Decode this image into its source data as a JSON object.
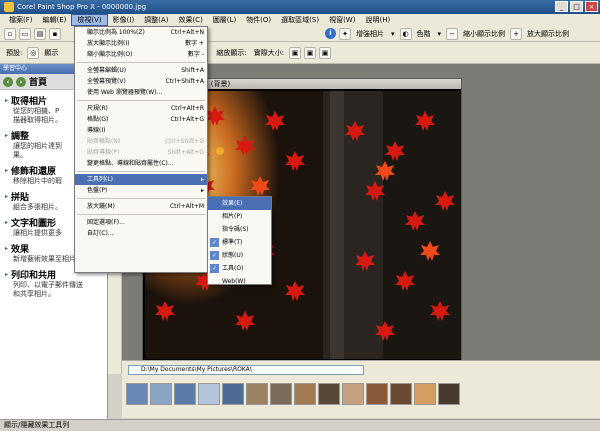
{
  "window": {
    "title": "Corel Paint Shop Pro X - 0000000.jpg",
    "min": "_",
    "max": "□",
    "close": "×"
  },
  "menu": [
    {
      "label": "檔案(F)"
    },
    {
      "label": "編輯(E)"
    },
    {
      "label": "檢視(V)",
      "active": true
    },
    {
      "label": "影像(I)"
    },
    {
      "label": "調整(A)"
    },
    {
      "label": "效果(C)"
    },
    {
      "label": "圖層(L)"
    },
    {
      "label": "物件(O)"
    },
    {
      "label": "選取區域(S)"
    },
    {
      "label": "視窗(W)"
    },
    {
      "label": "說明(H)"
    }
  ],
  "toolbar2": {
    "preset": "預設:",
    "display": "顯示",
    "zoom_display": "縮放顯示:",
    "actual_size": "實際大小:"
  },
  "toolbar1": {
    "enhance": "增強相片",
    "color": "色階",
    "zoom_out_display": "縮小顯示比例",
    "zoom_in_display": "放大顯示比例"
  },
  "learning_center": {
    "title": "學習中心",
    "home": "首頁",
    "sections": [
      {
        "heading": "取得相片",
        "desc1": "從您的相機、P",
        "desc2": "描器取得相片。"
      },
      {
        "heading": "調整",
        "desc1": "讓您的相片達到",
        "desc2": "果。"
      },
      {
        "heading": "修飾和還原",
        "desc1": "移除相片中的瑕",
        "desc2": ""
      },
      {
        "heading": "拼貼",
        "desc1": "組合多張相片。",
        "desc2": ""
      },
      {
        "heading": "文字和圖形",
        "desc1": "讓相片提供更多",
        "desc2": ""
      },
      {
        "heading": "效果",
        "desc1": "新增藝術效果至相片。",
        "desc2": ""
      },
      {
        "heading": "列印和共用",
        "desc1": "列印、以電子郵件傳送",
        "desc2": "和共享相片。"
      }
    ]
  },
  "image_window": {
    "title": "58% (背景)"
  },
  "view_menu": [
    {
      "label": "顯示比例為 100%(Z)",
      "shortcut": "Ctrl+Alt+N"
    },
    {
      "label": "放大顯示比例(I)",
      "shortcut": "數字 +"
    },
    {
      "label": "縮小顯示比例(O)",
      "shortcut": "數字 -"
    },
    {
      "sep": true
    },
    {
      "label": "全螢幕編輯(U)",
      "shortcut": "Shift+A"
    },
    {
      "label": "全螢幕預覽(V)",
      "shortcut": "Ctrl+Shift+A"
    },
    {
      "label": "使用 Web 瀏覽器預覽(W)...",
      "shortcut": ""
    },
    {
      "sep": true
    },
    {
      "label": "尺規(R)",
      "shortcut": "Ctrl+Alt+R"
    },
    {
      "label": "格點(G)",
      "shortcut": "Ctrl+Alt+G"
    },
    {
      "label": "導線(I)",
      "shortcut": ""
    },
    {
      "label": "貼齊格點(N)",
      "shortcut": "Ctrl+Shift+G",
      "disabled": true
    },
    {
      "label": "貼齊導線(P)",
      "shortcut": "Shift+Alt+G",
      "disabled": true
    },
    {
      "label": "變更格點、導線和貼齊屬性(C)...",
      "shortcut": ""
    },
    {
      "sep": true
    },
    {
      "label": "工具列(L)",
      "shortcut": "▸",
      "highlight": true
    },
    {
      "label": "色盤(P)",
      "shortcut": "▸"
    },
    {
      "sep": true
    },
    {
      "label": "放大鏡(M)",
      "shortcut": "Ctrl+Alt+M"
    },
    {
      "sep": true
    },
    {
      "label": "固定選項(F)...",
      "shortcut": ""
    },
    {
      "label": "自訂(C)...",
      "shortcut": ""
    }
  ],
  "toolbars_submenu": [
    {
      "label": "效果(E)",
      "checked": false,
      "highlight": true
    },
    {
      "label": "相片(P)",
      "checked": false
    },
    {
      "label": "指令碼(S)",
      "checked": false
    },
    {
      "label": "標準(T)",
      "checked": true
    },
    {
      "label": "狀態(U)",
      "checked": true
    },
    {
      "label": "工具(O)",
      "checked": true
    },
    {
      "label": "Web(W)",
      "checked": false
    }
  ],
  "browser": {
    "path": "D:\\My Documents\\My Pictures\\ROKA\\"
  },
  "status": {
    "text": "顯示/隱藏效果工具列"
  },
  "colors": {
    "accent": "#4b6fb4",
    "title": "#1f4e89",
    "leaf_red": "#d61a12"
  }
}
